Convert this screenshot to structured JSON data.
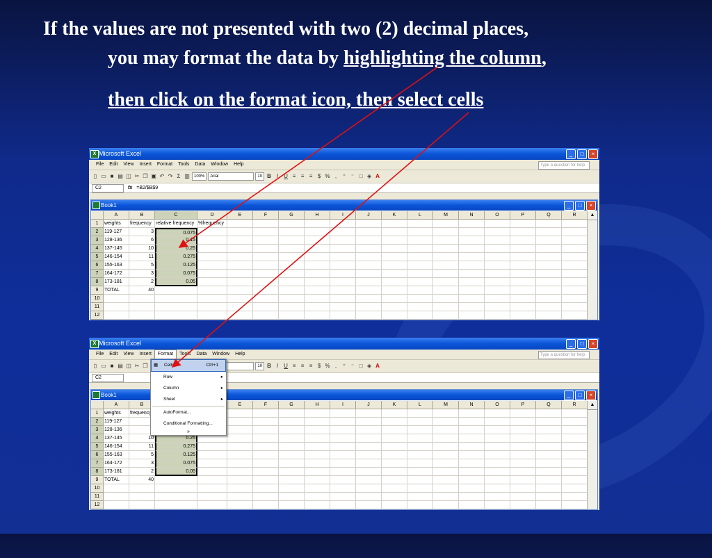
{
  "slide": {
    "line1": "If  the values are not presented with two (2) decimal places,",
    "line2_prefix": "you may format the data by ",
    "line2_link": "highlighting the column",
    "line2_suffix": ",",
    "line3": "then click on the format icon, then select cells"
  },
  "excel": {
    "window_title": "Microsoft Excel",
    "book_title": "Book1",
    "menu": [
      "File",
      "Edit",
      "View",
      "Insert",
      "Format",
      "Tools",
      "Data",
      "Window",
      "Help"
    ],
    "help_placeholder": "Type a question for help",
    "name_box": "C2",
    "formula": "=B2/$B$9",
    "fx": "fx",
    "zoom": "100%",
    "font": "Arial",
    "font_size": "10",
    "columns": [
      "A",
      "B",
      "C",
      "D",
      "E",
      "F",
      "G",
      "H",
      "I",
      "J",
      "K",
      "L",
      "M",
      "N",
      "O",
      "P",
      "Q",
      "R"
    ],
    "rows": [
      {
        "n": "1",
        "a": "weights",
        "b": "frequency",
        "c": "relative frequency",
        "d": "%frequency"
      },
      {
        "n": "2",
        "a": "119-127",
        "b": "3",
        "c": "0.075",
        "d": ""
      },
      {
        "n": "3",
        "a": "128-136",
        "b": "6",
        "c": "0.15",
        "d": ""
      },
      {
        "n": "4",
        "a": "137-145",
        "b": "10",
        "c": "0.25",
        "d": ""
      },
      {
        "n": "5",
        "a": "146-154",
        "b": "11",
        "c": "0.275",
        "d": ""
      },
      {
        "n": "6",
        "a": "155-163",
        "b": "5",
        "c": "0.125",
        "d": ""
      },
      {
        "n": "7",
        "a": "164-172",
        "b": "3",
        "c": "0.075",
        "d": ""
      },
      {
        "n": "8",
        "a": "173-181",
        "b": "2",
        "c": "0.05",
        "d": ""
      },
      {
        "n": "9",
        "a": "TOTAL",
        "b": "40",
        "c": "",
        "d": ""
      },
      {
        "n": "10",
        "a": "",
        "b": "",
        "c": "",
        "d": ""
      },
      {
        "n": "11",
        "a": "",
        "b": "",
        "c": "",
        "d": ""
      },
      {
        "n": "12",
        "a": "",
        "b": "",
        "c": "",
        "d": ""
      }
    ],
    "format_menu": {
      "cells": "Cells...",
      "cells_shortcut": "Ctrl+1",
      "row": "Row",
      "column": "Column",
      "sheet": "Sheet",
      "autoformat": "AutoFormat...",
      "conditional": "Conditional Formatting...",
      "more": "»"
    }
  },
  "colors": {
    "arrow": "#e01010",
    "title_bar": "#0a55d8",
    "selection": "#cdd3b8"
  }
}
